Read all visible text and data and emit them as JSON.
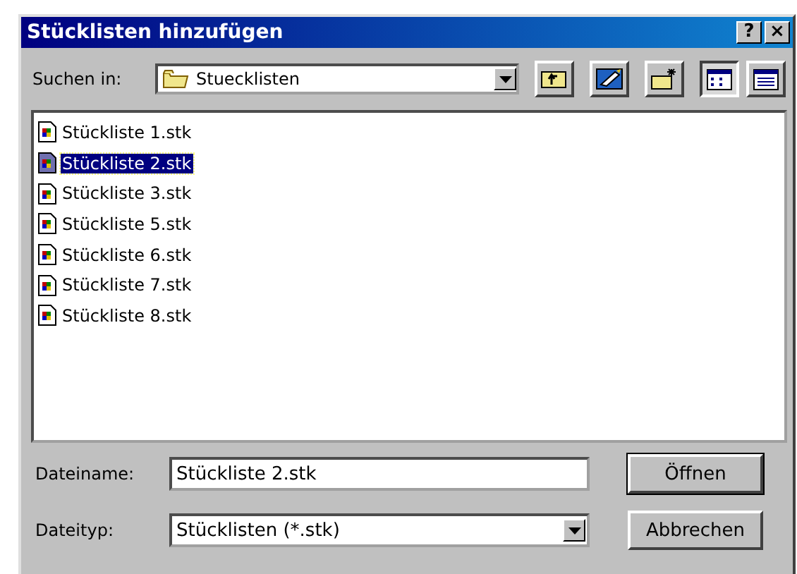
{
  "window": {
    "title": "Stücklisten hinzufügen",
    "help_button": "?",
    "close_button": "×"
  },
  "look_in": {
    "label": "Suchen in:",
    "value": "Stuecklisten"
  },
  "views": [
    {
      "kind": "list",
      "selected": true
    },
    {
      "kind": "details",
      "selected": false
    }
  ],
  "files": [
    {
      "name": "Stückliste 1.stk",
      "selected": false
    },
    {
      "name": "Stückliste 2.stk",
      "selected": true
    },
    {
      "name": "Stückliste 3.stk",
      "selected": false
    },
    {
      "name": "Stückliste 5.stk",
      "selected": false
    },
    {
      "name": "Stückliste 6.stk",
      "selected": false
    },
    {
      "name": "Stückliste 7.stk",
      "selected": false
    },
    {
      "name": "Stückliste 8.stk",
      "selected": false
    }
  ],
  "filename": {
    "label": "Dateiname:",
    "value": "Stückliste 2.stk"
  },
  "filetype": {
    "label": "Dateityp:",
    "value": "Stücklisten (*.stk)"
  },
  "buttons": [
    "Öffnen",
    "Abbrechen"
  ]
}
